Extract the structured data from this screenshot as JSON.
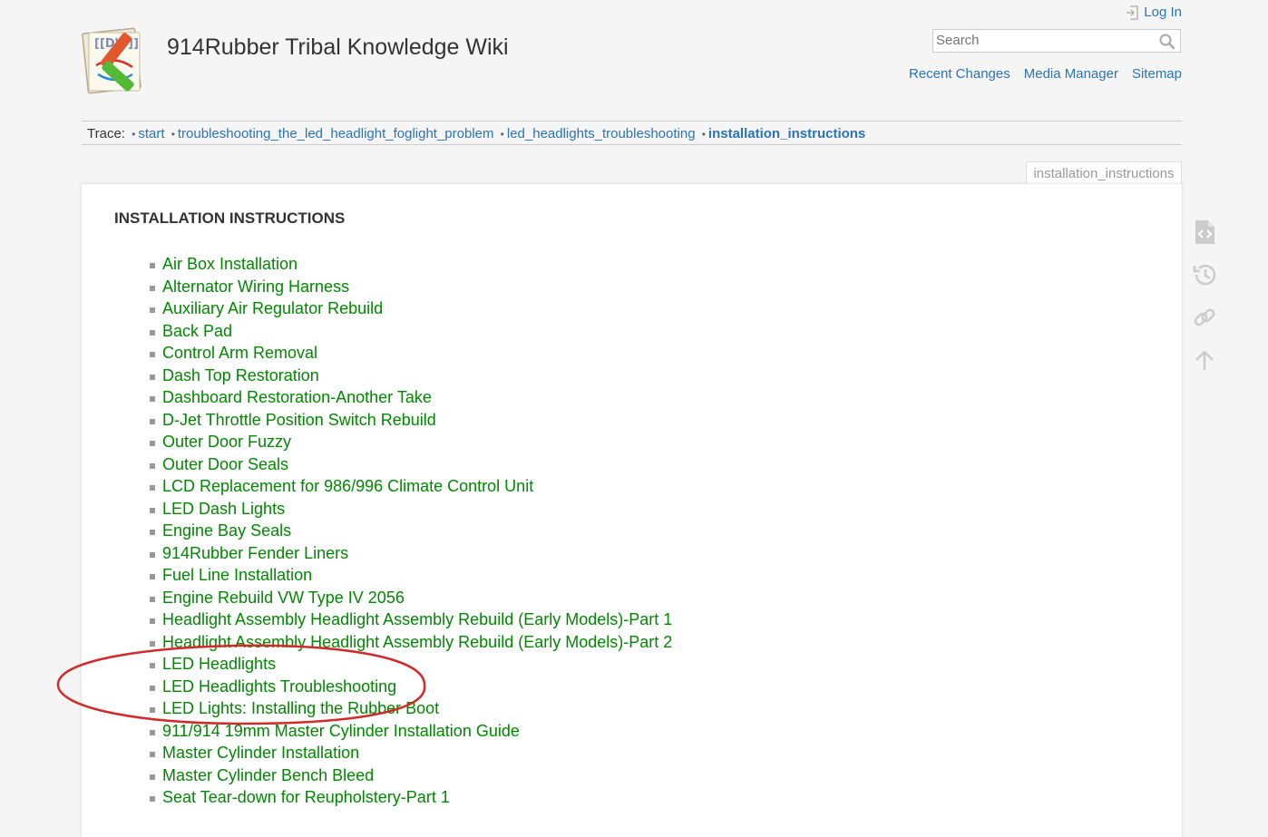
{
  "header": {
    "logo_text": "[[DW]]",
    "title": "914Rubber Tribal Knowledge Wiki",
    "login_label": "Log In",
    "search_placeholder": "Search",
    "tools": [
      "Recent Changes",
      "Media Manager",
      "Sitemap"
    ]
  },
  "trace": {
    "label": "Trace:",
    "crumbs": [
      "start",
      "troubleshooting_the_led_headlight_foglight_problem",
      "led_headlights_troubleshooting",
      "installation_instructions"
    ]
  },
  "page_tab": "installation_instructions",
  "content": {
    "heading": "INSTALLATION INSTRUCTIONS",
    "links": [
      "Air Box Installation",
      "Alternator Wiring Harness",
      "Auxiliary Air Regulator Rebuild",
      "Back Pad",
      "Control Arm Removal",
      "Dash Top Restoration",
      "Dashboard Restoration-Another Take",
      "D-Jet Throttle Position Switch Rebuild",
      "Outer Door Fuzzy",
      "Outer Door Seals",
      "LCD Replacement for 986/996 Climate Control Unit",
      "LED Dash Lights",
      "Engine Bay Seals",
      "914Rubber Fender Liners",
      "Fuel Line Installation",
      "Engine Rebuild VW Type IV 2056",
      "Headlight Assembly Headlight Assembly Rebuild (Early Models)-Part 1",
      "Headlight Assembly Headlight Assembly Rebuild (Early Models)-Part 2",
      "LED Headlights",
      "LED Headlights Troubleshooting",
      "LED Lights: Installing the Rubber Boot",
      "911/914 19mm Master Cylinder Installation Guide",
      "Master Cylinder Installation",
      "Master Cylinder Bench Bleed",
      "Seat Tear-down for Reupholstery-Part 1"
    ]
  },
  "pagetools_icons": [
    "show-source-icon",
    "old-revisions-icon",
    "backlinks-icon",
    "back-to-top-icon"
  ],
  "colors": {
    "link_blue": "#2b73b7",
    "content_link_green": "#008800",
    "annotation_red": "#d22a2a"
  }
}
